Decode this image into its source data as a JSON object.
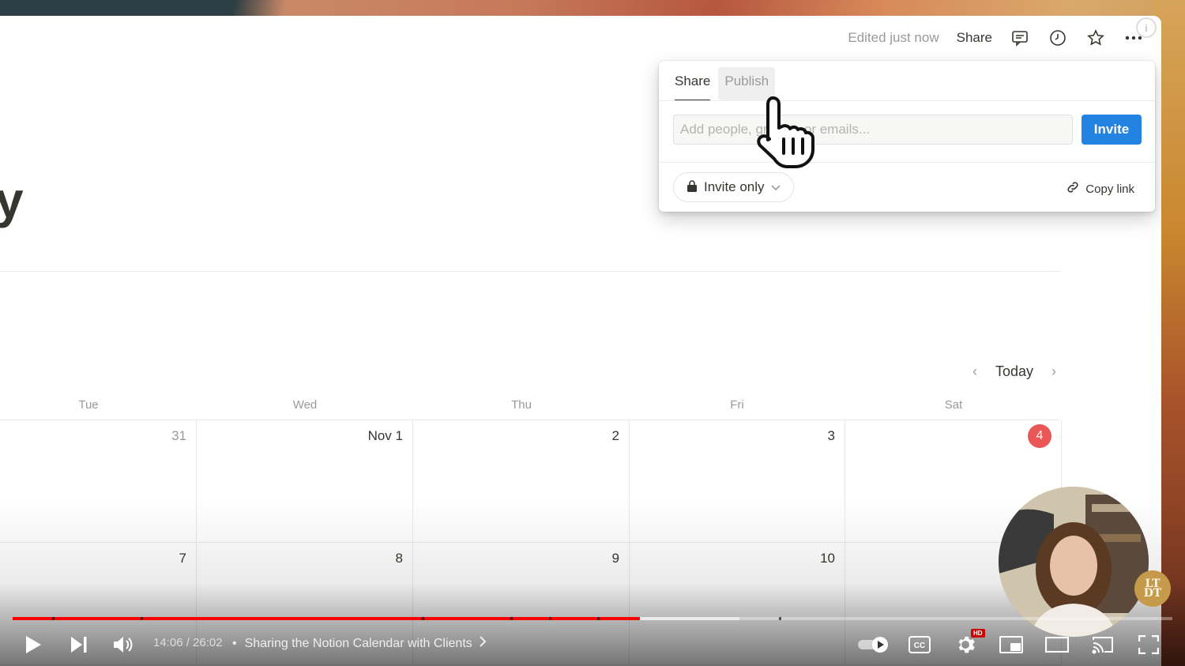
{
  "topbar": {
    "edited_label": "Edited just now",
    "share_label": "Share",
    "icons": [
      "comment-icon",
      "clock-icon",
      "star-icon",
      "more-icon"
    ]
  },
  "page": {
    "title_fragment": "y"
  },
  "share_popover": {
    "tabs": [
      {
        "label": "Share",
        "active": true
      },
      {
        "label": "Publish",
        "active": false
      }
    ],
    "input_placeholder": "Add people, groups, or emails...",
    "invite_label": "Invite",
    "access_label": "Invite only",
    "copy_link_label": "Copy link"
  },
  "calendar": {
    "today_label": "Today",
    "weekdays": [
      "Tue",
      "Wed",
      "Thu",
      "Fri",
      "Sat"
    ],
    "weeks": [
      [
        {
          "label": "31",
          "muted": true
        },
        {
          "label": "Nov 1"
        },
        {
          "label": "2"
        },
        {
          "label": "3"
        },
        {
          "label": "4",
          "today": true
        }
      ],
      [
        {
          "label": "7"
        },
        {
          "label": "8"
        },
        {
          "label": "9"
        },
        {
          "label": "10"
        },
        {
          "label": ""
        }
      ]
    ],
    "today_color": "#eb5757"
  },
  "video": {
    "time_current": "14:06",
    "time_total": "26:02",
    "time_display": "14:06 / 26:02",
    "chapter_title": "Sharing the Notion Calendar with Clients",
    "progress_fraction": 0.541,
    "buffer_fraction": 0.627,
    "progress_color": "#ff0000",
    "hd_label": "HD",
    "channel_logo": "LT DT"
  }
}
